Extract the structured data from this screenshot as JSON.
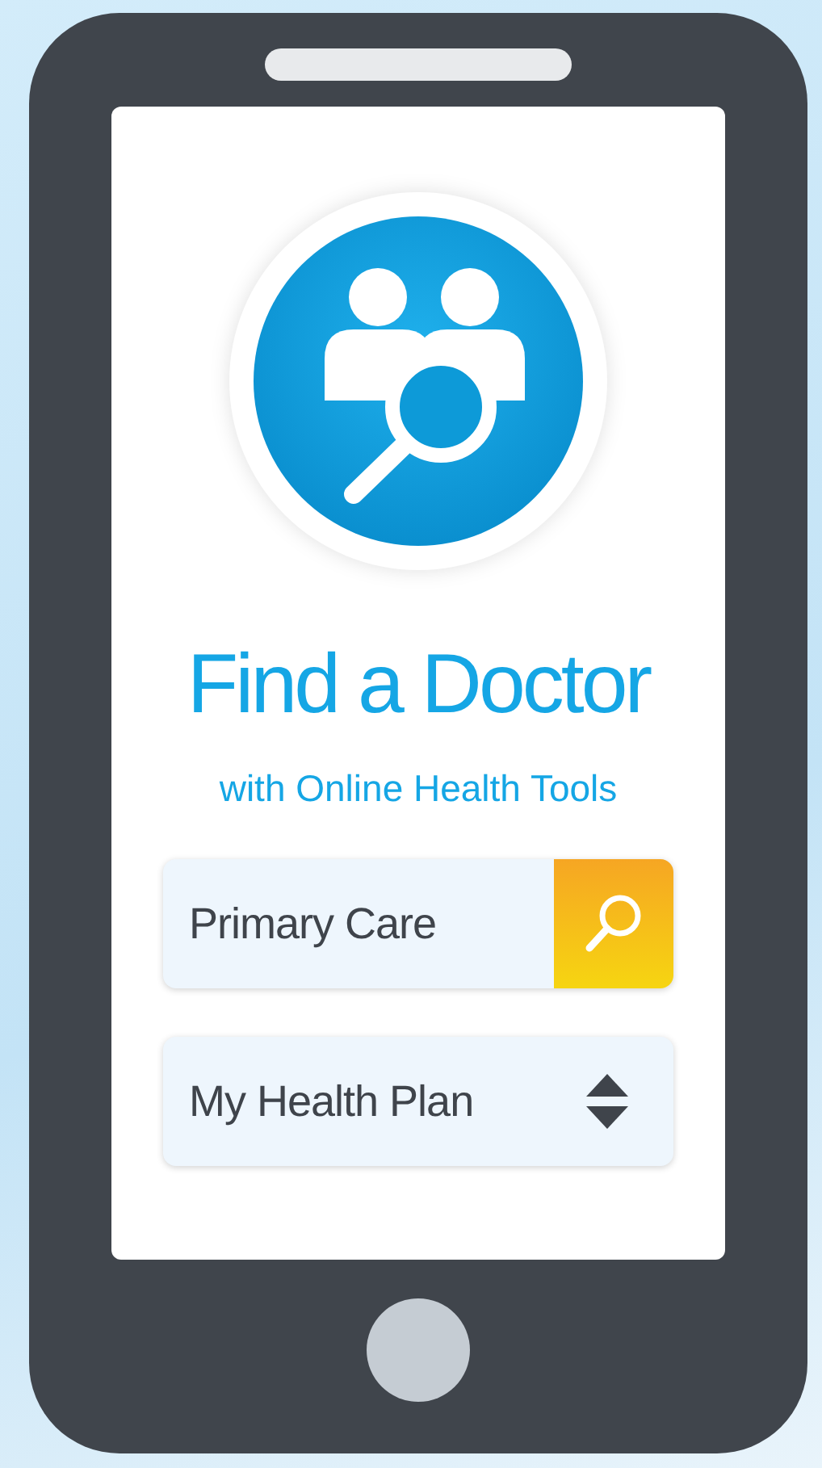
{
  "app": {
    "title": "Find a Doctor",
    "subtitle": "with Online Health Tools"
  },
  "search": {
    "value": "Primary Care"
  },
  "plan_select": {
    "value": "My Health Plan"
  }
}
